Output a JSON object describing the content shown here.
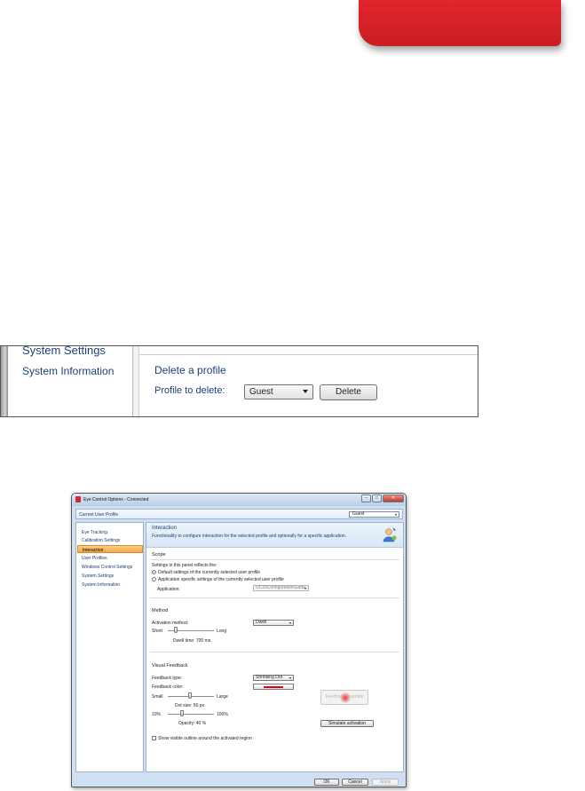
{
  "zoom": {
    "nav_items": [
      "System Settings",
      "System Information"
    ],
    "delete_heading": "Delete a profile",
    "profile_label": "Profile to delete:",
    "profile_value": "Guest",
    "delete_button": "Delete"
  },
  "window": {
    "title": "Eye Control Options - Connected",
    "title_buttons": {
      "minimize": "–",
      "maximize": "□",
      "close": "✕"
    },
    "profile_bar": {
      "label": "Current User Profile",
      "value": "Guest"
    },
    "sidebar": {
      "items": [
        "Eye Tracking",
        "Calibration Settings",
        "Interaction",
        "User Profiles",
        "Windows Control Settings",
        "System Settings",
        "System Information"
      ],
      "selected_index": 2
    },
    "header": {
      "title": "Interaction",
      "description": "Functionality to configure interaction for the selected profile and optionally for a specific application."
    },
    "scope": {
      "title": "Scope",
      "intro": "Settings in this panel reflects the:",
      "option_default": "Default settings of the currently selected user profile",
      "option_app": "Application specific settings of the currently selected user profile",
      "application_label": "Application:",
      "application_value": "UC20ConfigurationGuide"
    },
    "method": {
      "title": "Method",
      "activation_label": "Activation method:",
      "activation_value": "Dwell",
      "short_label": "Short",
      "long_label": "Long",
      "dwell_time": "Dwell time: 700 ms"
    },
    "visual": {
      "title": "Visual Feedback",
      "type_label": "Feedback type:",
      "type_value": "Shrinking Dot",
      "color_label": "Feedback color:",
      "color_value": "#e3001b",
      "small_label": "Small",
      "large_label": "Large",
      "dot_size": "Dot size: 50 px",
      "min_opacity": "10%",
      "max_opacity": "100%",
      "opacity": "Opacity: 40 %",
      "preview_label": "Feedback Example",
      "simulate_button": "Simulate activation",
      "outline_checkbox": "Show visible outline around the activated region"
    },
    "footer": {
      "ok": "OK",
      "cancel": "Cancel",
      "apply": "Apply"
    }
  }
}
